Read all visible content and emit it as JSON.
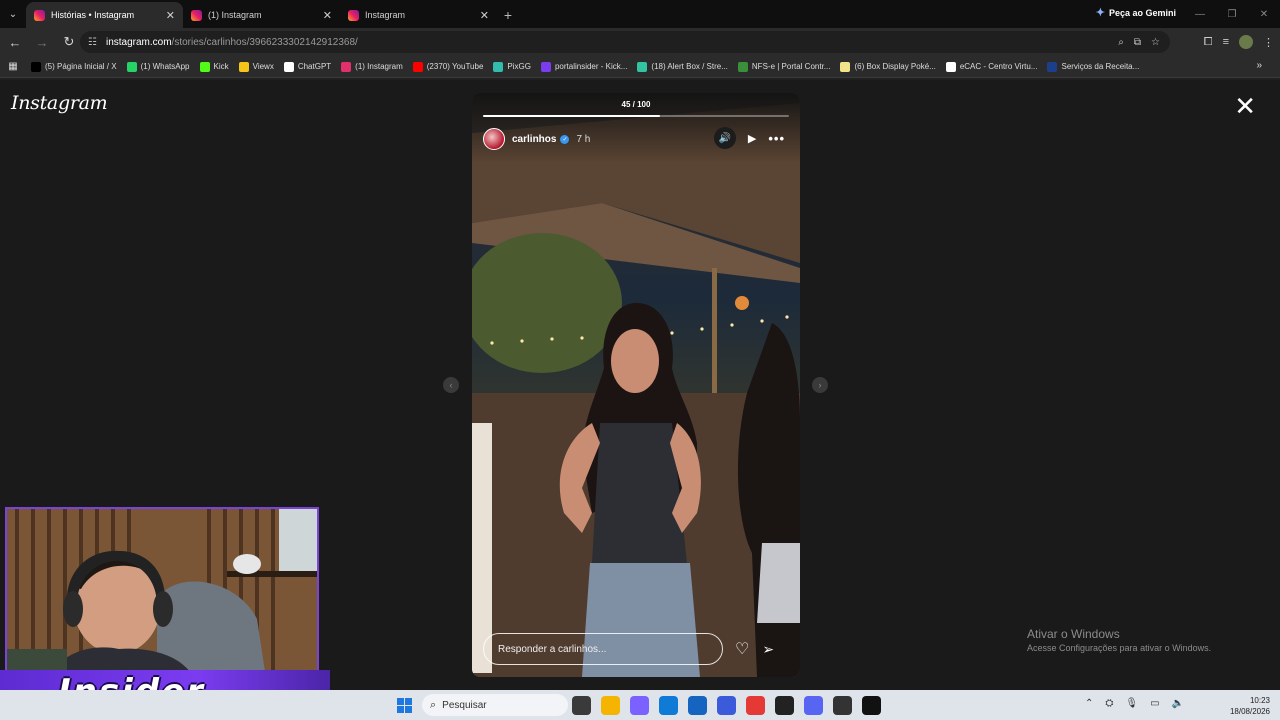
{
  "browser": {
    "tabs": [
      {
        "title": "Histórias • Instagram",
        "active": true
      },
      {
        "title": "(1) Instagram",
        "active": false
      },
      {
        "title": "Instagram",
        "active": false
      }
    ],
    "gemini_label": "Peça ao Gemini",
    "url_host": "instagram.com",
    "url_path": "/stories/carlinhos/3966233302142912368/",
    "bookmarks": [
      {
        "label": "(5) Página Inicial / X",
        "color": "#000000"
      },
      {
        "label": "(1) WhatsApp",
        "color": "#25d366"
      },
      {
        "label": "Kick",
        "color": "#53fc18"
      },
      {
        "label": "Viewx",
        "color": "#f5c518"
      },
      {
        "label": "ChatGPT",
        "color": "#ffffff"
      },
      {
        "label": "(1) Instagram",
        "color": "#e1306c"
      },
      {
        "label": "(2370) YouTube",
        "color": "#ff0000"
      },
      {
        "label": "PixGG",
        "color": "#32bcad"
      },
      {
        "label": "portalinsider - Kick...",
        "color": "#7b3cf0"
      },
      {
        "label": "(18) Alert Box / Stre...",
        "color": "#31c3a2"
      },
      {
        "label": "NFS-e | Portal Contr...",
        "color": "#3a8f3a"
      },
      {
        "label": "(6) Box Display Poké...",
        "color": "#f2e28a"
      },
      {
        "label": "eCAC - Centro Virtu...",
        "color": "#ffffff"
      },
      {
        "label": "Serviços da Receita...",
        "color": "#1b3f8b"
      }
    ]
  },
  "instagram": {
    "logo": "Instagram",
    "story": {
      "counter": "45 / 100",
      "progress": 0.58,
      "username": "carlinhos",
      "verified": true,
      "time": "7 h",
      "reply_placeholder": "Responder a carlinhos..."
    }
  },
  "overlay": {
    "brand_text": "Insider",
    "brand_color": "#7b3cf0"
  },
  "windows": {
    "activate_title": "Ativar o Windows",
    "activate_sub": "Acesse Configurações para ativar o Windows.",
    "search_placeholder": "Pesquisar",
    "time": "10:23",
    "date": "18/08/2026"
  }
}
